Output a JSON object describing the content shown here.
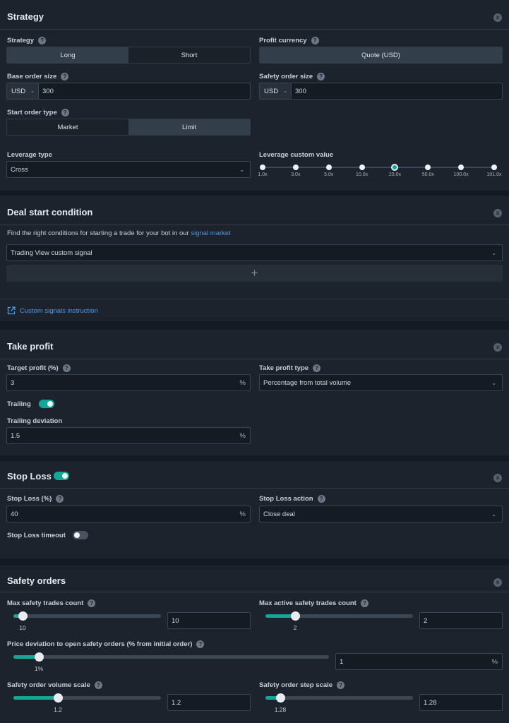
{
  "strategy_section": {
    "title": "Strategy",
    "collapse_glyph": "x",
    "strategy_label": "Strategy",
    "strategy_options": [
      "Long",
      "Short"
    ],
    "profit_currency_label": "Profit currency",
    "profit_currency_value": "Quote (USD)",
    "base_order_label": "Base order size",
    "base_currency": "USD",
    "base_value": "300",
    "safety_order_label": "Safety order size",
    "safety_currency": "USD",
    "safety_value": "300",
    "start_order_label": "Start order type",
    "start_order_options": [
      "Market",
      "Limit"
    ],
    "leverage_type_label": "Leverage type",
    "leverage_type_value": "Cross",
    "leverage_custom_label": "Leverage custom value",
    "leverage_ticks": [
      "1.0x",
      "3.0x",
      "5.0x",
      "10.0x",
      "20.0x",
      "50.0x",
      "100.0x",
      "101.0x"
    ],
    "leverage_selected": "20.0x"
  },
  "deal_section": {
    "title": "Deal start condition",
    "collapse_glyph": "x",
    "hint": "Find the right conditions for starting a trade for your bot in our",
    "hint_link": "signal market",
    "signal_value": "Trading View custom signal",
    "add_glyph": "+",
    "instruction_link": "Custom signals instruction"
  },
  "take_profit_section": {
    "title": "Take profit",
    "collapse_glyph": "x",
    "target_label": "Target profit (%)",
    "target_value": "3",
    "unit": "%",
    "type_label": "Take profit type",
    "type_value": "Percentage from total volume",
    "trailing_label": "Trailing",
    "trailing_on": true,
    "deviation_label": "Trailing deviation",
    "deviation_value": "1.5"
  },
  "stop_loss_section": {
    "title": "Stop Loss",
    "collapse_glyph": "x",
    "enabled": true,
    "value_label": "Stop Loss (%)",
    "value": "40",
    "unit": "%",
    "action_label": "Stop Loss action",
    "action_value": "Close deal",
    "timeout_label": "Stop Loss timeout",
    "timeout_on": false
  },
  "safety_section": {
    "title": "Safety orders",
    "collapse_glyph": "x",
    "max_trades_label": "Max safety trades count",
    "max_trades_value": "10",
    "max_trades_fraction": 0.06,
    "max_active_label": "Max active safety trades count",
    "max_active_value": "2",
    "max_active_fraction": 0.2,
    "deviation_label": "Price deviation to open safety orders (% from initial order)",
    "deviation_value": "1",
    "deviation_slider_label": "1%",
    "deviation_fraction": 0.08,
    "deviation_unit": "%",
    "volume_scale_label": "Safety order volume scale",
    "volume_scale_value": "1.2",
    "volume_scale_fraction": 0.3,
    "step_scale_label": "Safety order step scale",
    "step_scale_value": "1.28",
    "step_scale_fraction": 0.1
  },
  "colors": {
    "accent": "#11a898",
    "panel": "#1c232c",
    "background": "#141a22",
    "link": "#4c9be8"
  },
  "icons": {
    "help": "question-circle-icon",
    "collapse": "collapse-icon",
    "chevron": "chevron-down-icon",
    "external": "external-link-icon",
    "plus": "plus-icon"
  }
}
